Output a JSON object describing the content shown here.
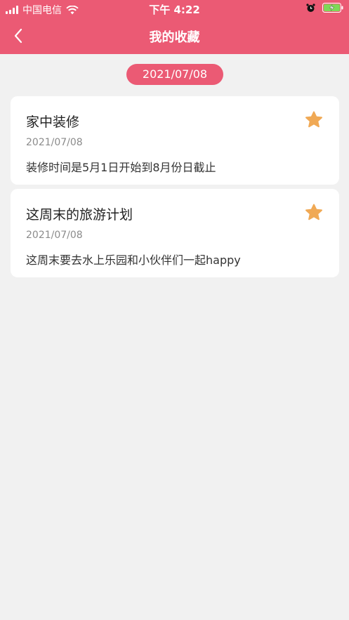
{
  "status_bar": {
    "carrier": "中国电信",
    "time": "下午 4:22"
  },
  "nav": {
    "title": "我的收藏"
  },
  "date_group": "2021/07/08",
  "items": [
    {
      "title": "家中装修",
      "date": "2021/07/08",
      "desc": "装修时间是5月1日开始到8月份日截止"
    },
    {
      "title": "这周末的旅游计划",
      "date": "2021/07/08",
      "desc": "这周末要去水上乐园和小伙伴们一起happy"
    }
  ],
  "colors": {
    "accent": "#eb5a74",
    "star": "#f0a955",
    "background": "#f1f1f1"
  }
}
